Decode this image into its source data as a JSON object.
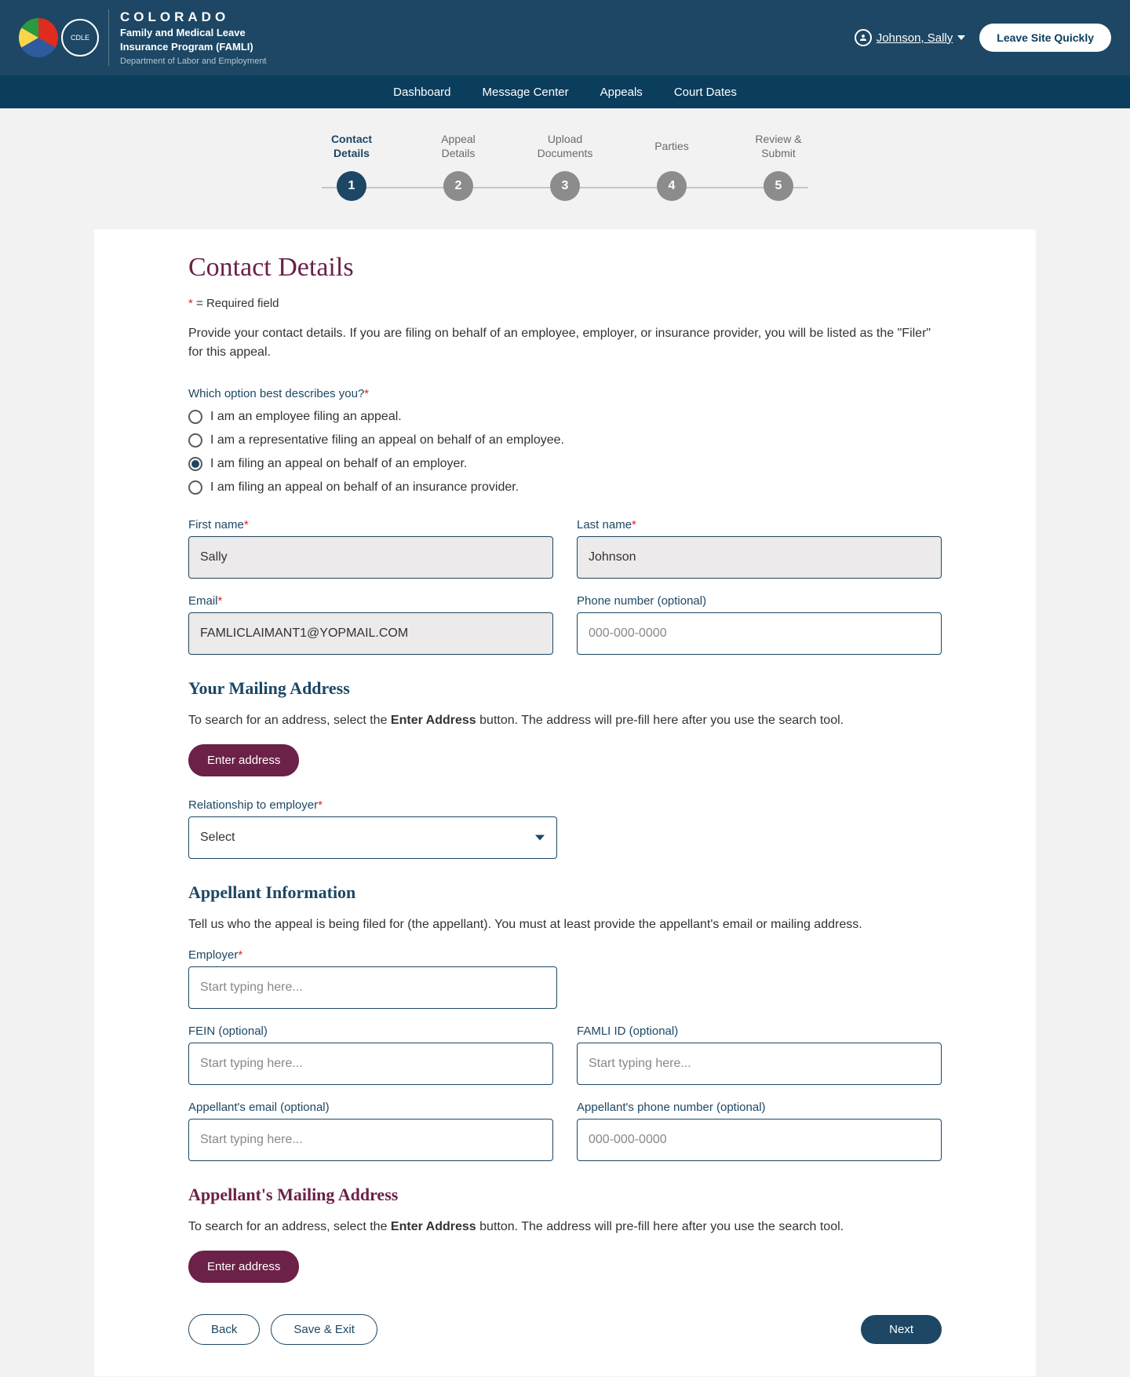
{
  "header": {
    "logo_title": "COLORADO",
    "logo_sub_line1": "Family and Medical Leave",
    "logo_sub_line2": "Insurance Program (FAMLI)",
    "logo_dept": "Department of Labor and Employment",
    "user_name": "Johnson, Sally",
    "leave_label": "Leave Site Quickly"
  },
  "nav": {
    "items": [
      "Dashboard",
      "Message Center",
      "Appeals",
      "Court Dates"
    ]
  },
  "stepper": {
    "steps": [
      {
        "label_line1": "Contact",
        "label_line2": "Details",
        "num": "1"
      },
      {
        "label_line1": "Appeal",
        "label_line2": "Details",
        "num": "2"
      },
      {
        "label_line1": "Upload",
        "label_line2": "Documents",
        "num": "3"
      },
      {
        "label_line1": "Parties",
        "label_line2": "",
        "num": "4"
      },
      {
        "label_line1": "Review &",
        "label_line2": "Submit",
        "num": "5"
      }
    ]
  },
  "page": {
    "title": "Contact Details",
    "required_note": " = Required field",
    "intro": "Provide your contact details. If you are filing on behalf of an employee, employer, or insurance provider, you will be listed as the \"Filer\" for this appeal."
  },
  "radios": {
    "question": "Which option best describes you?",
    "options": [
      "I am an employee filing an appeal.",
      "I am a representative filing an appeal on behalf of an employee.",
      "I am filing an appeal on behalf of an employer.",
      "I am filing an appeal on behalf of an insurance provider."
    ],
    "selected_index": 2
  },
  "fields": {
    "first_name_label": "First name",
    "first_name_value": "Sally",
    "last_name_label": "Last name",
    "last_name_value": "Johnson",
    "email_label": "Email",
    "email_value": "FAMLICLAIMANT1@YOPMAIL.COM",
    "phone_label": "Phone number (optional)",
    "phone_placeholder": "000-000-0000"
  },
  "mailing": {
    "title": "Your Mailing Address",
    "text_prefix": "To search for an address, select the ",
    "text_bold": "Enter Address",
    "text_suffix": " button. The address will pre-fill here after you use the search tool.",
    "enter_btn": "Enter address"
  },
  "relationship": {
    "label": "Relationship to employer",
    "selected": "Select"
  },
  "appellant": {
    "title": "Appellant Information",
    "text": "Tell us who the appeal is being filed for (the appellant). You must at least provide the appellant's email or mailing address.",
    "employer_label": "Employer",
    "employer_placeholder": "Start typing here...",
    "fein_label": "FEIN (optional)",
    "fein_placeholder": "Start typing here...",
    "famli_label": "FAMLI ID (optional)",
    "famli_placeholder": "Start typing here...",
    "email_label": "Appellant's email (optional)",
    "email_placeholder": "Start typing here...",
    "phone_label": "Appellant's phone number (optional)",
    "phone_placeholder": "000-000-0000",
    "mailing_title": "Appellant's Mailing Address"
  },
  "footer": {
    "back": "Back",
    "save_exit": "Save & Exit",
    "next": "Next"
  }
}
